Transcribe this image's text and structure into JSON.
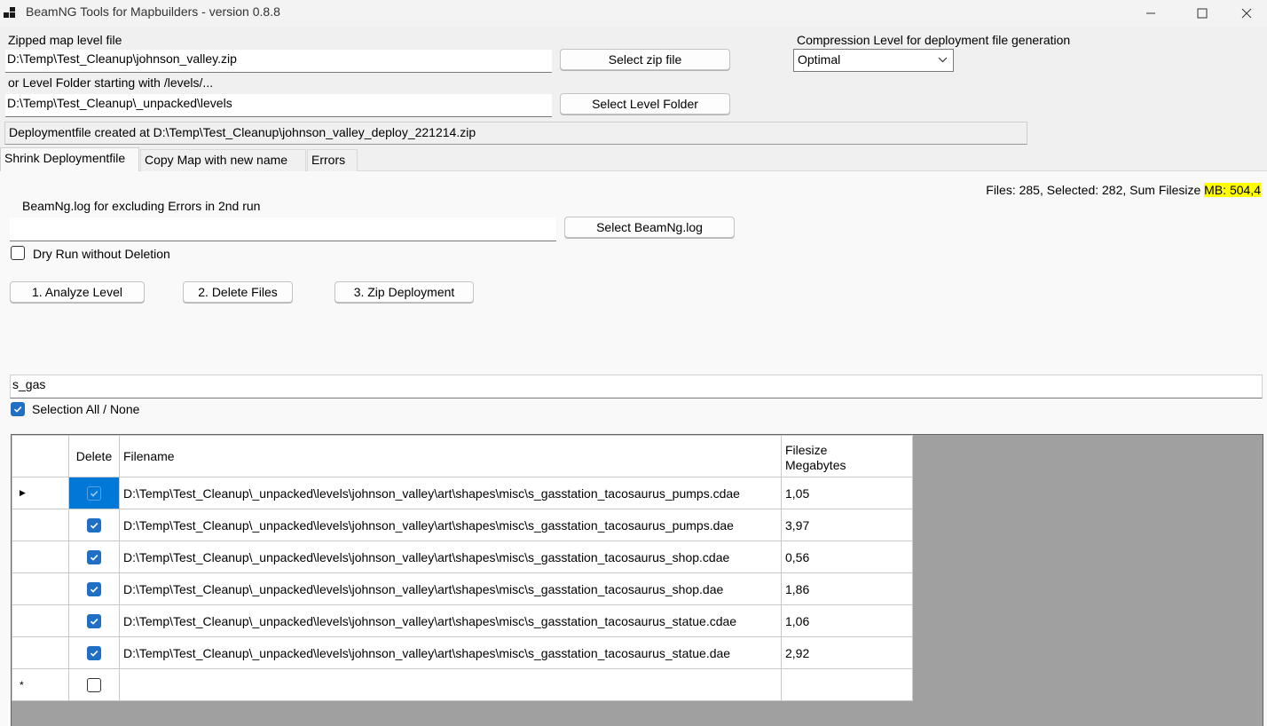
{
  "window": {
    "title": "BeamNG Tools for Mapbuilders - version 0.8.8",
    "min_glyph": "—",
    "max_glyph": "☐",
    "close_glyph": "✕"
  },
  "top": {
    "zip_label": "Zipped map level file",
    "zip_value": "D:\\Temp\\Test_Cleanup\\johnson_valley.zip",
    "select_zip_label": "Select zip file",
    "folder_label": "or Level Folder starting with /levels/...",
    "folder_value": "D:\\Temp\\Test_Cleanup\\_unpacked\\levels",
    "select_folder_label": "Select Level Folder",
    "compression_label": "Compression Level for deployment file generation",
    "compression_value": "Optimal",
    "status": "Deploymentfile created at D:\\Temp\\Test_Cleanup\\johnson_valley_deploy_221214.zip"
  },
  "tabs": [
    {
      "label": "Shrink Deploymentfile",
      "active": true
    },
    {
      "label": "Copy Map with new name",
      "active": false
    },
    {
      "label": "Errors",
      "active": false
    }
  ],
  "shrink": {
    "stats_prefix": "Files: 285, Selected: 282, Sum Filesize ",
    "stats_highlight": "MB: 504,4",
    "log_label": "BeamNg.log for excluding Errors in 2nd run",
    "log_value": "",
    "select_log_label": "Select BeamNg.log",
    "dry_run_label": "Dry Run without Deletion",
    "dry_run_checked": false,
    "analyze_label": "1. Analyze Level",
    "delete_label": "2. Delete Files",
    "zip_label": "3. Zip Deployment",
    "filter_value": "s_gas",
    "select_all_label": "Selection All / None",
    "select_all_checked": true
  },
  "grid": {
    "columns": [
      "",
      "Delete",
      "Filename",
      "Filesize\nMegabytes"
    ],
    "col_size_line1": "Filesize",
    "col_size_line2": "Megabytes",
    "rows": [
      {
        "indicator": "▶",
        "delete": true,
        "filename": "D:\\Temp\\Test_Cleanup\\_unpacked\\levels\\johnson_valley\\art\\shapes\\misc\\s_gasstation_tacosaurus_pumps.cdae",
        "size": "1,05"
      },
      {
        "indicator": "",
        "delete": true,
        "filename": "D:\\Temp\\Test_Cleanup\\_unpacked\\levels\\johnson_valley\\art\\shapes\\misc\\s_gasstation_tacosaurus_pumps.dae",
        "size": "3,97"
      },
      {
        "indicator": "",
        "delete": true,
        "filename": "D:\\Temp\\Test_Cleanup\\_unpacked\\levels\\johnson_valley\\art\\shapes\\misc\\s_gasstation_tacosaurus_shop.cdae",
        "size": "0,56"
      },
      {
        "indicator": "",
        "delete": true,
        "filename": "D:\\Temp\\Test_Cleanup\\_unpacked\\levels\\johnson_valley\\art\\shapes\\misc\\s_gasstation_tacosaurus_shop.dae",
        "size": "1,86"
      },
      {
        "indicator": "",
        "delete": true,
        "filename": "D:\\Temp\\Test_Cleanup\\_unpacked\\levels\\johnson_valley\\art\\shapes\\misc\\s_gasstation_tacosaurus_statue.cdae",
        "size": "1,06"
      },
      {
        "indicator": "",
        "delete": true,
        "filename": "D:\\Temp\\Test_Cleanup\\_unpacked\\levels\\johnson_valley\\art\\shapes\\misc\\s_gasstation_tacosaurus_statue.dae",
        "size": "2,92"
      },
      {
        "indicator": "*",
        "delete": false,
        "filename": "",
        "size": ""
      }
    ]
  }
}
